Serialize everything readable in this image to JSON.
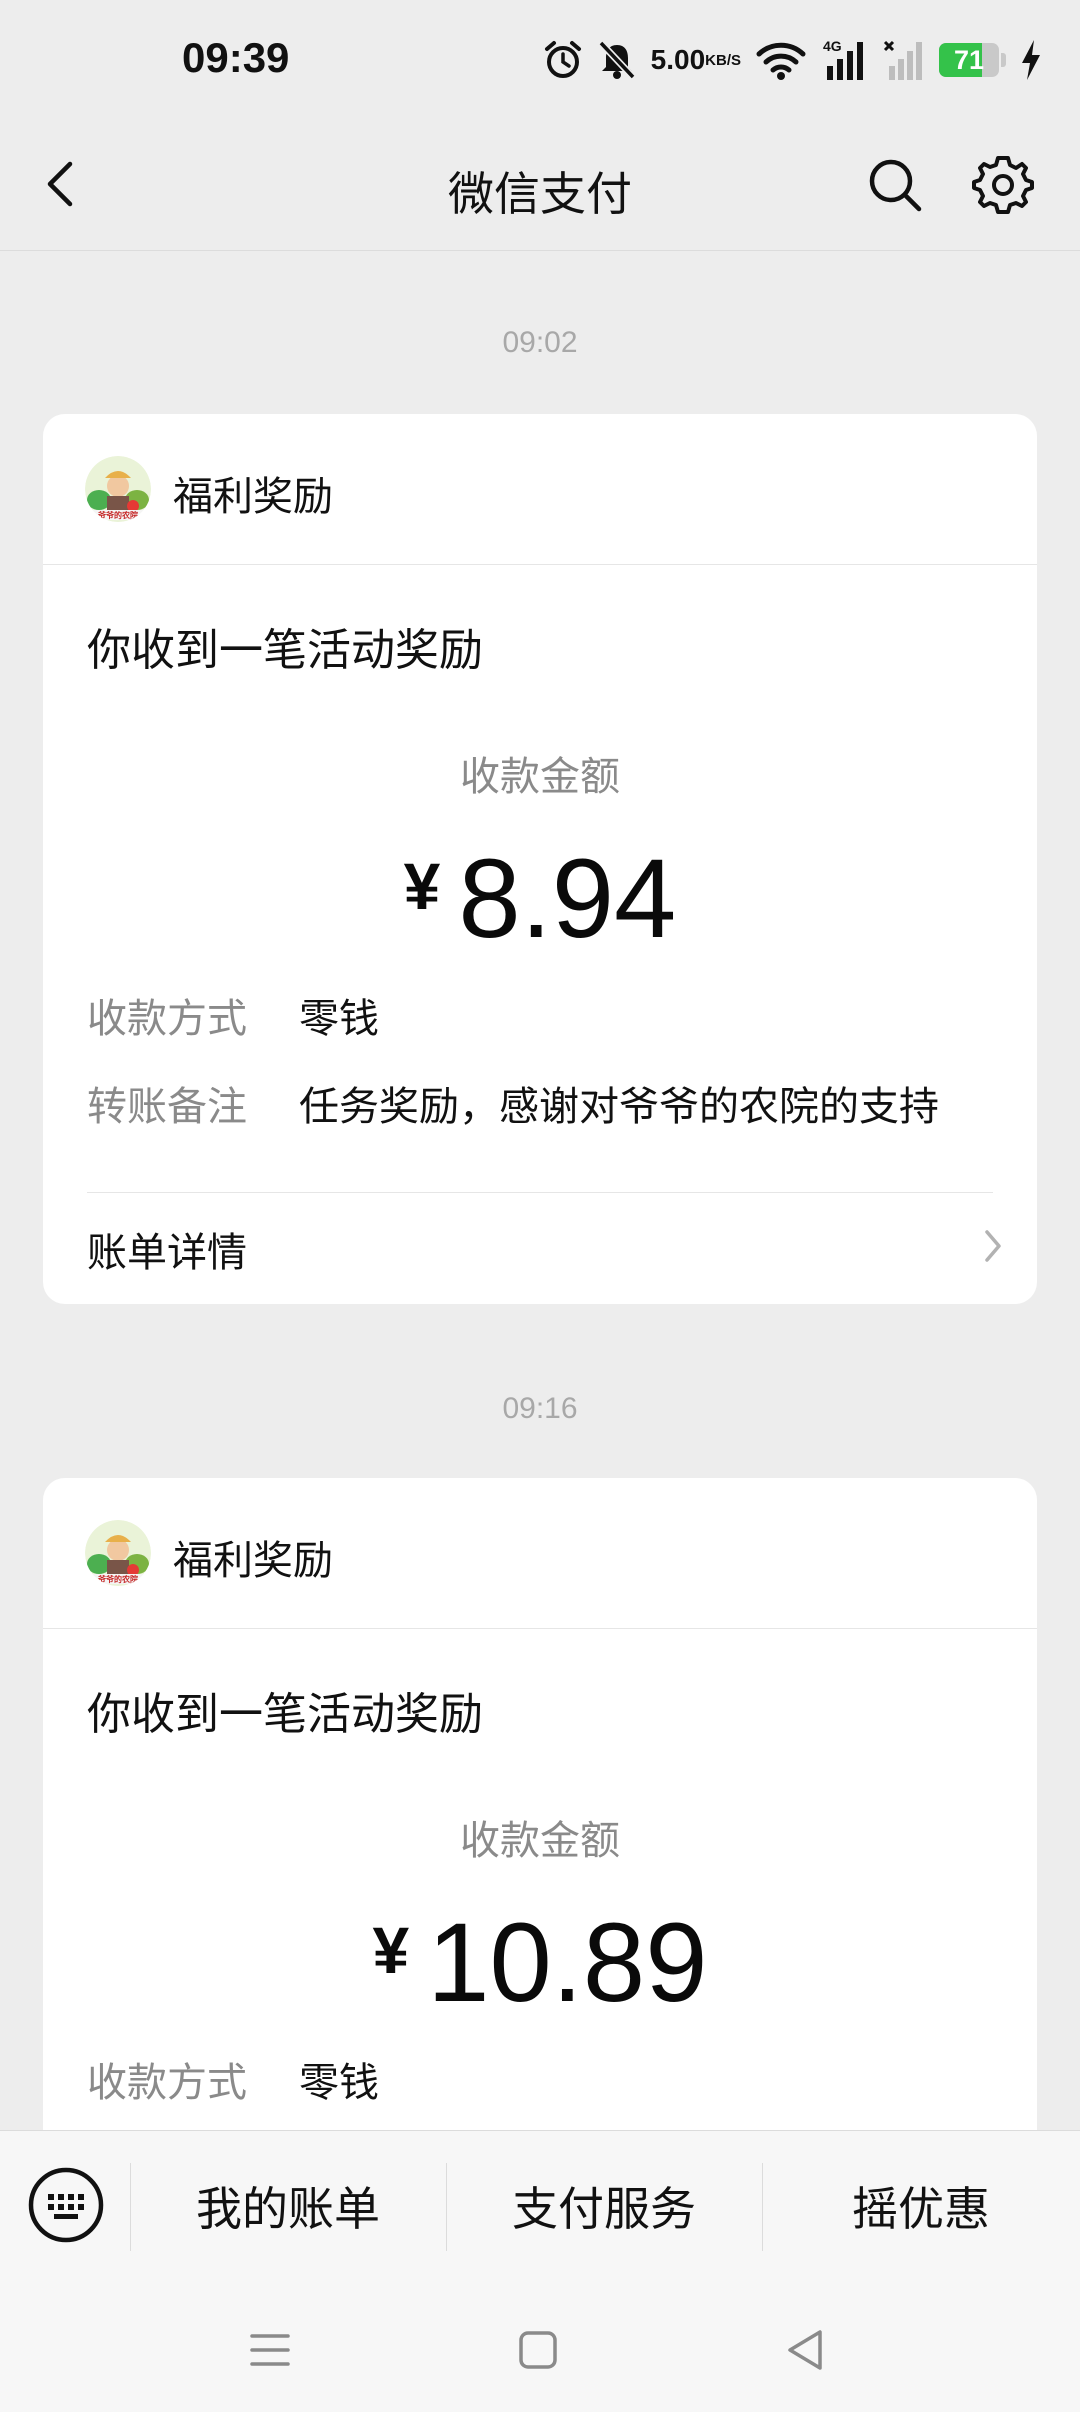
{
  "status_bar": {
    "time": "09:39",
    "net_speed_value": "5.00",
    "net_speed_unit": "KB/S",
    "network_type": "4G",
    "battery": "71",
    "battery_level": 0.71,
    "icons": [
      "alarm-icon",
      "mute-icon",
      "wifi-icon",
      "signal-icon",
      "signal-no-service-icon",
      "battery-icon",
      "charging-icon"
    ]
  },
  "header": {
    "title": "微信支付"
  },
  "messages": [
    {
      "timestamp": "09:02",
      "source": "福利奖励",
      "subject": "你收到一笔活动奖励",
      "amount_label": "收款金额",
      "currency": "¥",
      "amount": "8.94",
      "method_label": "收款方式",
      "method_value": "零钱",
      "note_label": "转账备注",
      "note_value": "任务奖励，感谢对爷爷的农院的支持",
      "details_label": "账单详情"
    },
    {
      "timestamp": "09:16",
      "source": "福利奖励",
      "subject": "你收到一笔活动奖励",
      "amount_label": "收款金额",
      "currency": "¥",
      "amount": "10.89",
      "method_label": "收款方式",
      "method_value": "零钱"
    }
  ],
  "bottom_menu": {
    "items": [
      "我的账单",
      "支付服务",
      "摇优惠"
    ]
  },
  "colors": {
    "background": "#ededed",
    "card": "#ffffff",
    "muted_text": "#8a8a8a",
    "battery_green": "#34c24a"
  }
}
